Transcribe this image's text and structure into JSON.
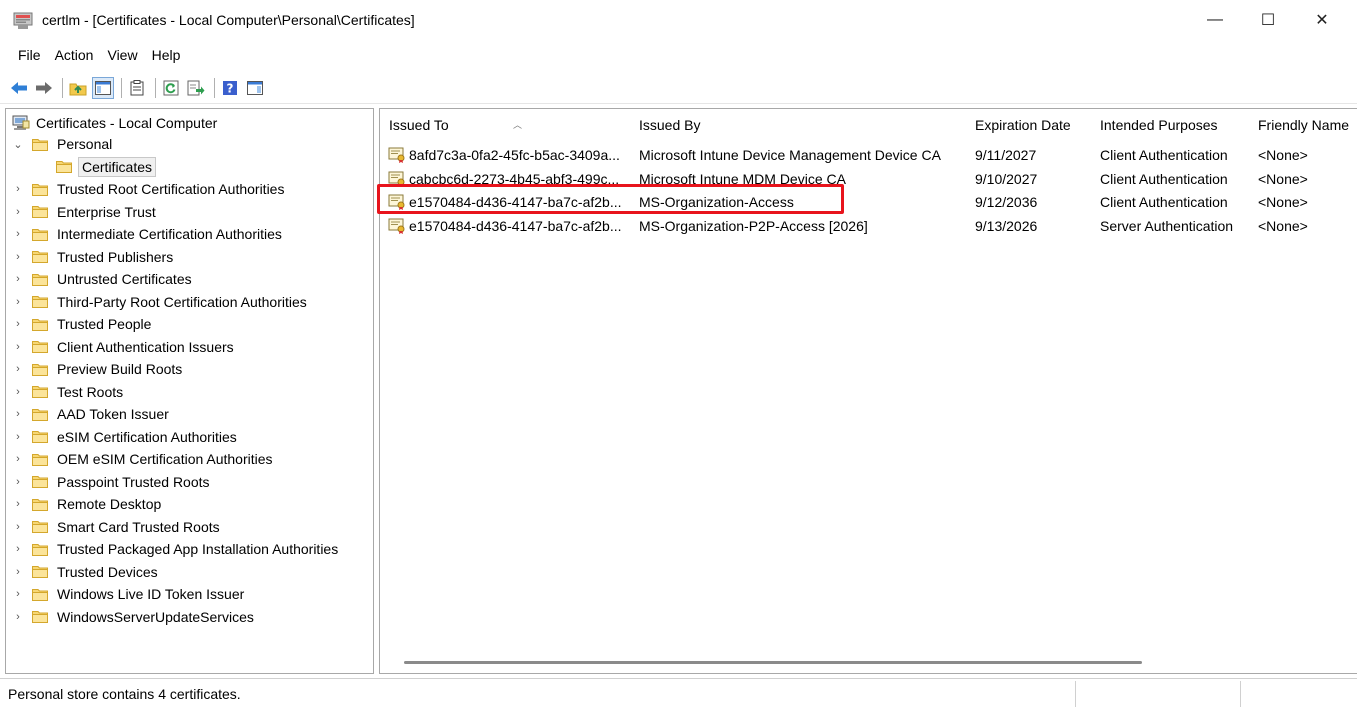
{
  "window": {
    "title": "certlm - [Certificates - Local Computer\\Personal\\Certificates]",
    "minimize": "—",
    "maximize": "☐",
    "close": "✕"
  },
  "menu": [
    "File",
    "Action",
    "View",
    "Help"
  ],
  "toolbar": {
    "icons": [
      "back-icon",
      "forward-icon",
      "up-folder-icon",
      "show-hide-tree-icon",
      "properties-icon",
      "refresh-icon",
      "export-list-icon",
      "help-icon",
      "action-pane-icon"
    ]
  },
  "tree": {
    "root": "Certificates - Local Computer",
    "items": [
      {
        "label": "Personal",
        "expanded": true
      },
      {
        "label": "Certificates",
        "selected": true,
        "child": true
      },
      {
        "label": "Trusted Root Certification Authorities"
      },
      {
        "label": "Enterprise Trust"
      },
      {
        "label": "Intermediate Certification Authorities"
      },
      {
        "label": "Trusted Publishers"
      },
      {
        "label": "Untrusted Certificates"
      },
      {
        "label": "Third-Party Root Certification Authorities"
      },
      {
        "label": "Trusted People"
      },
      {
        "label": "Client Authentication Issuers"
      },
      {
        "label": "Preview Build Roots"
      },
      {
        "label": "Test Roots"
      },
      {
        "label": "AAD Token Issuer"
      },
      {
        "label": "eSIM Certification Authorities"
      },
      {
        "label": "OEM eSIM Certification Authorities"
      },
      {
        "label": "Passpoint Trusted Roots"
      },
      {
        "label": "Remote Desktop"
      },
      {
        "label": "Smart Card Trusted Roots"
      },
      {
        "label": "Trusted Packaged App Installation Authorities"
      },
      {
        "label": "Trusted Devices"
      },
      {
        "label": "Windows Live ID Token Issuer"
      },
      {
        "label": "WindowsServerUpdateServices"
      }
    ]
  },
  "list": {
    "columns": [
      "Issued To",
      "Issued By",
      "Expiration Date",
      "Intended Purposes",
      "Friendly Name"
    ],
    "rows": [
      [
        "8afd7c3a-0fa2-45fc-b5ac-3409a...",
        "Microsoft Intune Device Management Device CA",
        "9/11/2027",
        "Client Authentication",
        "<None>"
      ],
      [
        "cabcbc6d-2273-4b45-abf3-499c...",
        "Microsoft Intune MDM Device CA",
        "9/10/2027",
        "Client Authentication",
        "<None>"
      ],
      [
        "e1570484-d436-4147-ba7c-af2b...",
        "MS-Organization-Access",
        "9/12/2036",
        "Client Authentication",
        "<None>"
      ],
      [
        "e1570484-d436-4147-ba7c-af2b...",
        "MS-Organization-P2P-Access [2026]",
        "9/13/2026",
        "Server Authentication",
        "<None>"
      ]
    ],
    "highlight_color": "#e8141c"
  },
  "status": {
    "text": "Personal store contains 4 certificates."
  }
}
